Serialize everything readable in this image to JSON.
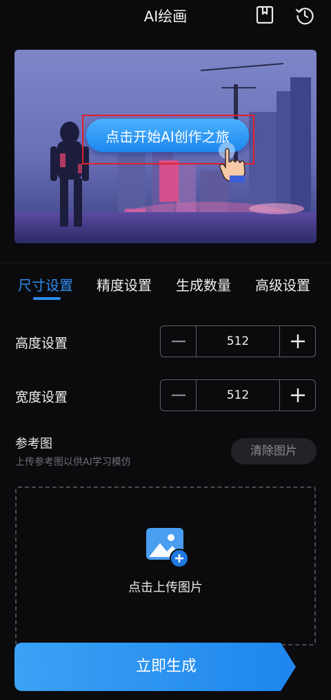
{
  "header": {
    "title": "AI绘画",
    "icons": [
      "bookmark-icon",
      "history-icon"
    ]
  },
  "banner": {
    "cta_label": "点击开始AI创作之旅"
  },
  "tabs": [
    {
      "label": "尺寸设置",
      "active": true
    },
    {
      "label": "精度设置",
      "active": false
    },
    {
      "label": "生成数量",
      "active": false
    },
    {
      "label": "高级设置",
      "active": false
    }
  ],
  "height_setting": {
    "label": "高度设置",
    "value": "512"
  },
  "width_setting": {
    "label": "宽度设置",
    "value": "512"
  },
  "reference": {
    "title": "参考图",
    "subtitle": "上传参考图以供AI学习模仿",
    "clear_label": "清除图片",
    "upload_label": "点击上传图片"
  },
  "generate": {
    "label": "立即生成"
  },
  "colors": {
    "accent": "#2e8cf0",
    "background": "#0b0b0d",
    "highlight_frame": "#e2202a"
  }
}
